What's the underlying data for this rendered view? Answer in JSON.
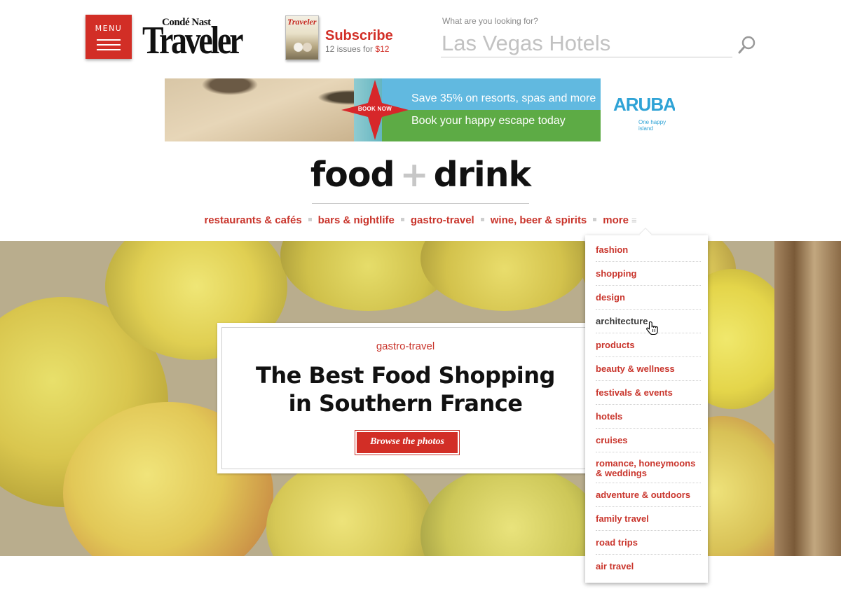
{
  "header": {
    "menu_label": "MENU",
    "logo_top": "Condé Nast",
    "logo_main": "Traveler",
    "magazine_cover_title": "Traveler",
    "subscribe_title": "Subscribe",
    "subscribe_line": "12 issues for",
    "subscribe_price": "$12",
    "search_label": "What are you looking for?",
    "search_placeholder": "Las Vegas Hotels"
  },
  "ad": {
    "badge": "BOOK NOW",
    "line1": "Save 35% on resorts, spas and more",
    "line2": "Book your happy escape today",
    "brand": "ARUBA",
    "tagline": "One happy island"
  },
  "section": {
    "title_left": "food",
    "title_plus": "+",
    "title_right": "drink"
  },
  "subnav": {
    "items": [
      "restaurants & cafés",
      "bars & nightlife",
      "gastro-travel",
      "wine, beer & spirits"
    ],
    "more": "more"
  },
  "hero": {
    "category": "gastro-travel",
    "title_line1": "The Best Food Shopping",
    "title_line2": "in Southern France",
    "button": "Browse the photos"
  },
  "dropdown": {
    "items": [
      "fashion",
      "shopping",
      "design",
      "architecture",
      "products",
      "beauty & wellness",
      "festivals & events",
      "hotels",
      "cruises",
      "romance, honeymoons & weddings",
      "adventure & outdoors",
      "family travel",
      "road trips",
      "air travel"
    ]
  },
  "colors": {
    "brand_red": "#d22e26",
    "link_red": "#c9352c"
  }
}
